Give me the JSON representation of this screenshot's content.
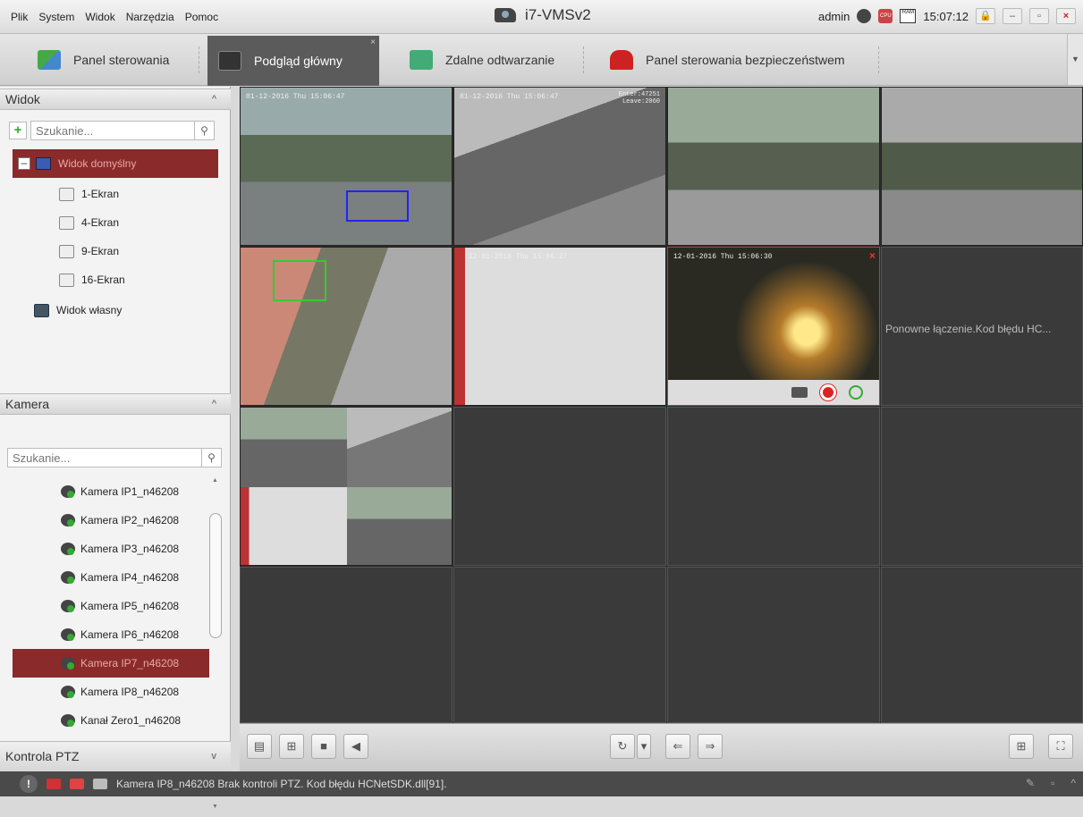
{
  "menu": [
    "Plik",
    "System",
    "Widok",
    "Narzędzia",
    "Pomoc"
  ],
  "app_title": "i7-VMSv2",
  "title_right": {
    "user": "admin",
    "ram_label": "RAM",
    "cpu_label": "CPU",
    "time": "15:07:12"
  },
  "tabs": [
    {
      "label": "Panel sterowania"
    },
    {
      "label": "Podgląd główny"
    },
    {
      "label": "Zdalne odtwarzanie"
    },
    {
      "label": "Panel sterowania bezpieczeństwem"
    }
  ],
  "view_section": {
    "title": "Widok",
    "search_placeholder": "Szukanie...",
    "root": "Widok domyślny",
    "items": [
      "1-Ekran",
      "4-Ekran",
      "9-Ekran",
      "16-Ekran"
    ],
    "custom": "Widok własny"
  },
  "camera_section": {
    "title": "Kamera",
    "search_placeholder": "Szukanie...",
    "cameras": [
      "Kamera IP1_n46208",
      "Kamera IP2_n46208",
      "Kamera IP3_n46208",
      "Kamera IP4_n46208",
      "Kamera IP5_n46208",
      "Kamera IP6_n46208",
      "Kamera IP7_n46208",
      "Kamera IP8_n46208",
      "Kanał Zero1_n46208"
    ],
    "selected_index": 6
  },
  "ptz_section": {
    "title": "Kontrola PTZ"
  },
  "video": {
    "osd": [
      "01-12-2016 Thu 15:06:47",
      "01-12-2016 Thu 15:06:47",
      "12-01-2016 Thu 15:06:27",
      "12-01-2016 Thu 15:06:30"
    ],
    "osd_counter": "Enter:47251\nLeave:2060",
    "error_text": "Ponowne łączenie.Kod błędu HC..."
  },
  "status": {
    "message": "Kamera IP8_n46208 Brak kontroli PTZ. Kod błędu HCNetSDK.dll[91]."
  },
  "colors": {
    "accent": "#8b2a2a",
    "grid_bg": "#2e2e2e",
    "status_bg": "#4a4a4a"
  }
}
